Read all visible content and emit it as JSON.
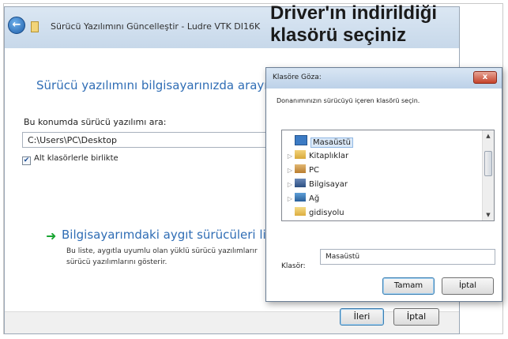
{
  "overlay": {
    "title_line1": "Driver'ın indirildiği",
    "title_line2": "klasörü seçiniz"
  },
  "window": {
    "title": "Sürücü Yazılımını Güncelleştir - Ludre VTK DI16K"
  },
  "main": {
    "heading": "Sürücü yazılımını bilgisayarınızda arayın",
    "field_label": "Bu konumda sürücü yazılımı ara:",
    "path_value": "C:\\Users\\PC\\Desktop",
    "checkbox_label": "Alt klasörlerle birlikte",
    "checkbox_checked": true,
    "link_title": "Bilgisayarımdaki aygıt sürücüleri listesinc",
    "link_desc_line1": "Bu liste, aygıtla uyumlu olan yüklü sürücü yazılımlarır",
    "link_desc_line2": "sürücü yazılımlarını gösterir."
  },
  "footer": {
    "next_label": "İleri",
    "cancel_label": "İptal"
  },
  "dialog": {
    "title": "Klasöre Göza:",
    "close_label": "x",
    "instruction": "Donanımınızın sürücüyü içeren klasörü seçin.",
    "tree_items": [
      {
        "label": "Masaüstü",
        "icon": "desktop-icon",
        "selected": true
      },
      {
        "label": "Kitaplıklar",
        "icon": "libraries-icon"
      },
      {
        "label": "PC",
        "icon": "user-icon"
      },
      {
        "label": "Bilgisayar",
        "icon": "computer-icon"
      },
      {
        "label": "Ağ",
        "icon": "network-icon"
      },
      {
        "label": "gidisyolu",
        "icon": "folder-icon"
      }
    ],
    "folder_label": "Klasör:",
    "folder_value": "Masaüstü",
    "ok_label": "Tamam",
    "cancel_label": "İptal"
  },
  "colors": {
    "accent": "#2f6db5",
    "arrow": "#19a532",
    "close": "#c5432b"
  }
}
